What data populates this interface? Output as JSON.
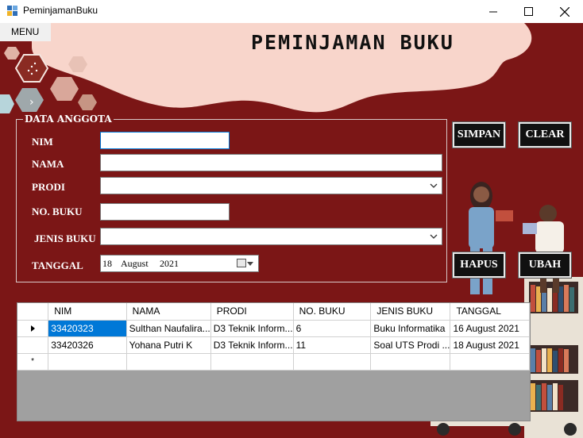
{
  "window": {
    "title": "PeminjamanBuku",
    "minimize_glyph": "—",
    "maximize_glyph": "☐",
    "close_glyph": "✕"
  },
  "menu": {
    "label": "MENU"
  },
  "heading": "PEMINJAMAN BUKU",
  "form": {
    "group_title": "DATA ANGGOTA",
    "labels": {
      "nim": "NIM",
      "nama": "NAMA",
      "prodi": "PRODI",
      "no_buku": "NO. BUKU",
      "jenis_buku": "JENIS BUKU",
      "tanggal": "TANGGAL"
    },
    "values": {
      "nim": "",
      "nama": "",
      "prodi": "",
      "no_buku": "",
      "jenis_buku": ""
    },
    "date": {
      "day": "18",
      "month": "August",
      "year": "2021"
    }
  },
  "buttons": {
    "simpan": "SIMPAN",
    "clear": "CLEAR",
    "hapus": "HAPUS",
    "ubah": "UBAH"
  },
  "grid": {
    "columns": [
      "NIM",
      "NAMA",
      "PRODI",
      "NO. BUKU",
      "JENIS BUKU",
      "TANGGAL"
    ],
    "rows": [
      [
        "33420323",
        "Sulthan Naufalira...",
        "D3 Teknik Inform...",
        "6",
        "Buku Informatika",
        "16 August 2021"
      ],
      [
        "33420326",
        "Yohana Putri K",
        "D3 Teknik Inform...",
        "11",
        "Soal UTS Prodi ...",
        "18 August 2021"
      ]
    ],
    "new_row_marker": "*"
  },
  "colors": {
    "background": "#7b1616",
    "blob": "#f8d5cb",
    "selection": "#0078d7"
  },
  "icons": [
    "app-icon",
    "minimize-icon",
    "maximize-icon",
    "close-icon",
    "chevron-down-icon",
    "calendar-icon",
    "row-pointer-icon"
  ]
}
